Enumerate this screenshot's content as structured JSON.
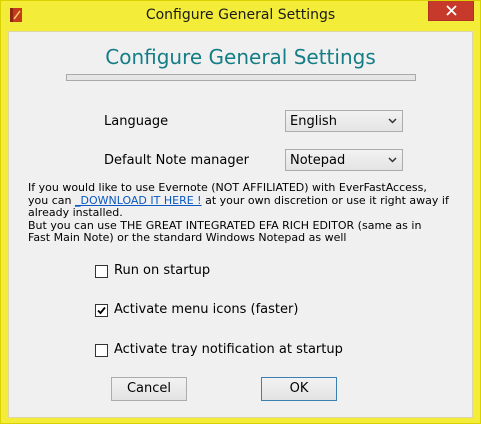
{
  "window": {
    "title": "Configure General Settings",
    "icon": "evernote-notebook-icon",
    "close_icon": "close-icon"
  },
  "heading": "Configure General Settings",
  "progress": {
    "value": 0
  },
  "language": {
    "label": "Language",
    "value": "English"
  },
  "note_manager": {
    "label": "Default Note manager",
    "value": "Notepad"
  },
  "info": {
    "line1": "If you would like to use Evernote (NOT AFFILIATED) with EverFastAccess,",
    "line2_before": "you can ",
    "link": "_DOWNLOAD IT HERE !",
    "line2_after": " at your own discretion or use it right away if",
    "line3": "already installed.",
    "line4": "But you can use THE GREAT INTEGRATED EFA RICH EDITOR (same as in",
    "line5": "Fast Main Note) or the standard Windows Notepad as well"
  },
  "options": [
    {
      "label": "Run on startup",
      "checked": false
    },
    {
      "label": "Activate menu icons (faster)",
      "checked": true
    },
    {
      "label": "Activate tray notification at startup",
      "checked": false
    }
  ],
  "buttons": {
    "cancel": "Cancel",
    "ok": "OK"
  },
  "colors": {
    "title_bar": "#f3ed3a",
    "heading": "#147d86",
    "close": "#c7392b",
    "link": "#0a57c2"
  }
}
